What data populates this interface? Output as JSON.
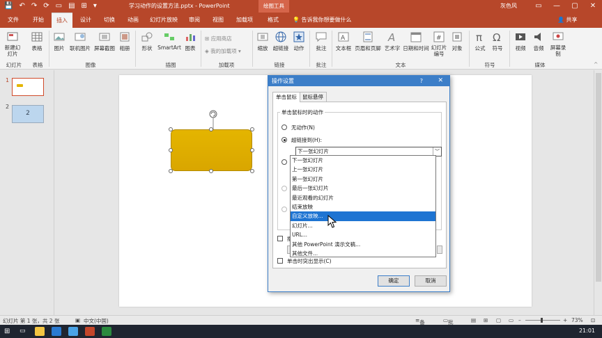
{
  "titlebar": {
    "doc_title": "学习动作的设置方法.pptx - PowerPoint",
    "tools_header": "绘图工具",
    "user": "灰色风",
    "qat": [
      "💾",
      "↶",
      "↷",
      "⟳",
      "▭",
      "▤",
      "⊞",
      "▾"
    ],
    "win": [
      "▭",
      "—",
      "▢",
      "✕"
    ]
  },
  "tabs": [
    {
      "label": "文件"
    },
    {
      "label": "开始"
    },
    {
      "label": "插入"
    },
    {
      "label": "设计"
    },
    {
      "label": "切换"
    },
    {
      "label": "动画"
    },
    {
      "label": "幻灯片放映"
    },
    {
      "label": "审阅"
    },
    {
      "label": "视图"
    },
    {
      "label": "加载项"
    },
    {
      "label": "格式"
    }
  ],
  "tell_me": "告诉我你想要做什么",
  "share": "共享",
  "ribbon": {
    "buttons": [
      "新建幻灯片",
      "表格",
      "图片",
      "联机图片",
      "屏幕截图",
      "相册",
      "形状",
      "SmartArt",
      "图表",
      "应用商店",
      "我的加载项",
      "缩放",
      "超链接",
      "动作",
      "批注",
      "文本框",
      "页眉和页脚",
      "艺术字",
      "日期和时间",
      "幻灯片编号",
      "对象",
      "公式",
      "符号",
      "视频",
      "音频",
      "屏幕录制"
    ],
    "groups": [
      "幻灯片",
      "表格",
      "图像",
      "插图",
      "加载项",
      "链接",
      "批注",
      "文本",
      "符号",
      "媒体"
    ]
  },
  "thumbnails": [
    {
      "num": "1"
    },
    {
      "num": "2",
      "text": "2"
    }
  ],
  "dialog": {
    "title": "操作设置",
    "help": "?",
    "close": "✕",
    "tabs": [
      "单击鼠标",
      "鼠标悬停"
    ],
    "legend": "单击鼠标时的动作",
    "opt_none": "无动作(N)",
    "opt_link": "超链接到(H):",
    "combo_value": "下一张幻灯片",
    "combo_arrow": "﹀",
    "dropdown_items": [
      "下一张幻灯片",
      "上一张幻灯片",
      "第一张幻灯片",
      "最后一张幻灯片",
      "最近观看的幻灯片",
      "结束放映",
      "自定义放映...",
      "幻灯片...",
      "URL...",
      "其他 PowerPoint 演示文稿...",
      "其他文件..."
    ],
    "selected_index": 6,
    "chk_play_label": "播",
    "chk_highlight": "单击时突出显示(C)",
    "ok": "确定",
    "cancel": "取消"
  },
  "status": {
    "slide_info": "幻灯片 第 1 张，共 2 张",
    "lang": "中文(中国)",
    "notes": "备注",
    "comments": "批注",
    "zoom": "73%"
  },
  "taskbar": {
    "time": "21:01"
  },
  "colors": {
    "accent": "#b7472a",
    "dialog": "#3c7ec8",
    "shape": "#e4b500",
    "highlight": "#1e74d2"
  }
}
